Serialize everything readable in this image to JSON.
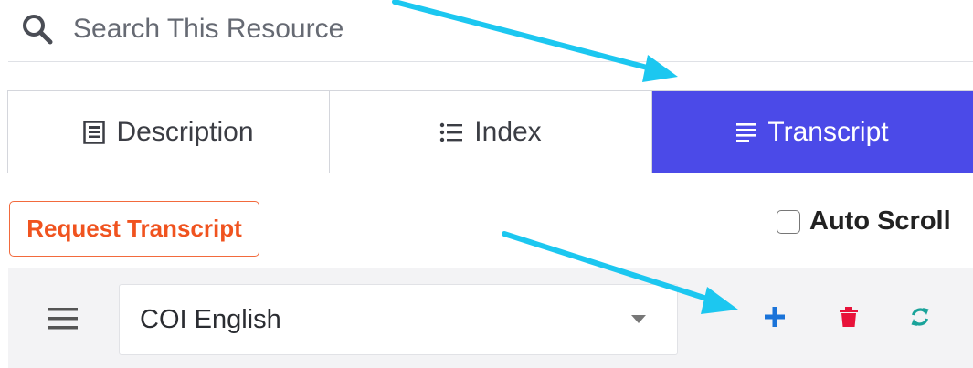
{
  "search": {
    "placeholder": "Search This Resource",
    "icon": "search-icon"
  },
  "tabs": [
    {
      "label": "Description",
      "icon": "document-icon",
      "active": false
    },
    {
      "label": "Index",
      "icon": "list-icon",
      "active": false
    },
    {
      "label": "Transcript",
      "icon": "text-lines-icon",
      "active": true
    }
  ],
  "request_transcript": {
    "label": "Request Transcript"
  },
  "auto_scroll": {
    "label": "Auto Scroll",
    "checked": false
  },
  "transcript_toolbar": {
    "selected_transcript": "COI English",
    "actions": [
      "add-icon",
      "trash-icon",
      "refresh-icon"
    ]
  },
  "colors": {
    "active_tab": "#4b4ae8",
    "request_button": "#f0531f",
    "add": "#1a73d9",
    "delete": "#e8123a",
    "refresh": "#1aa39a",
    "annotation_arrow": "#1cc7f0"
  }
}
